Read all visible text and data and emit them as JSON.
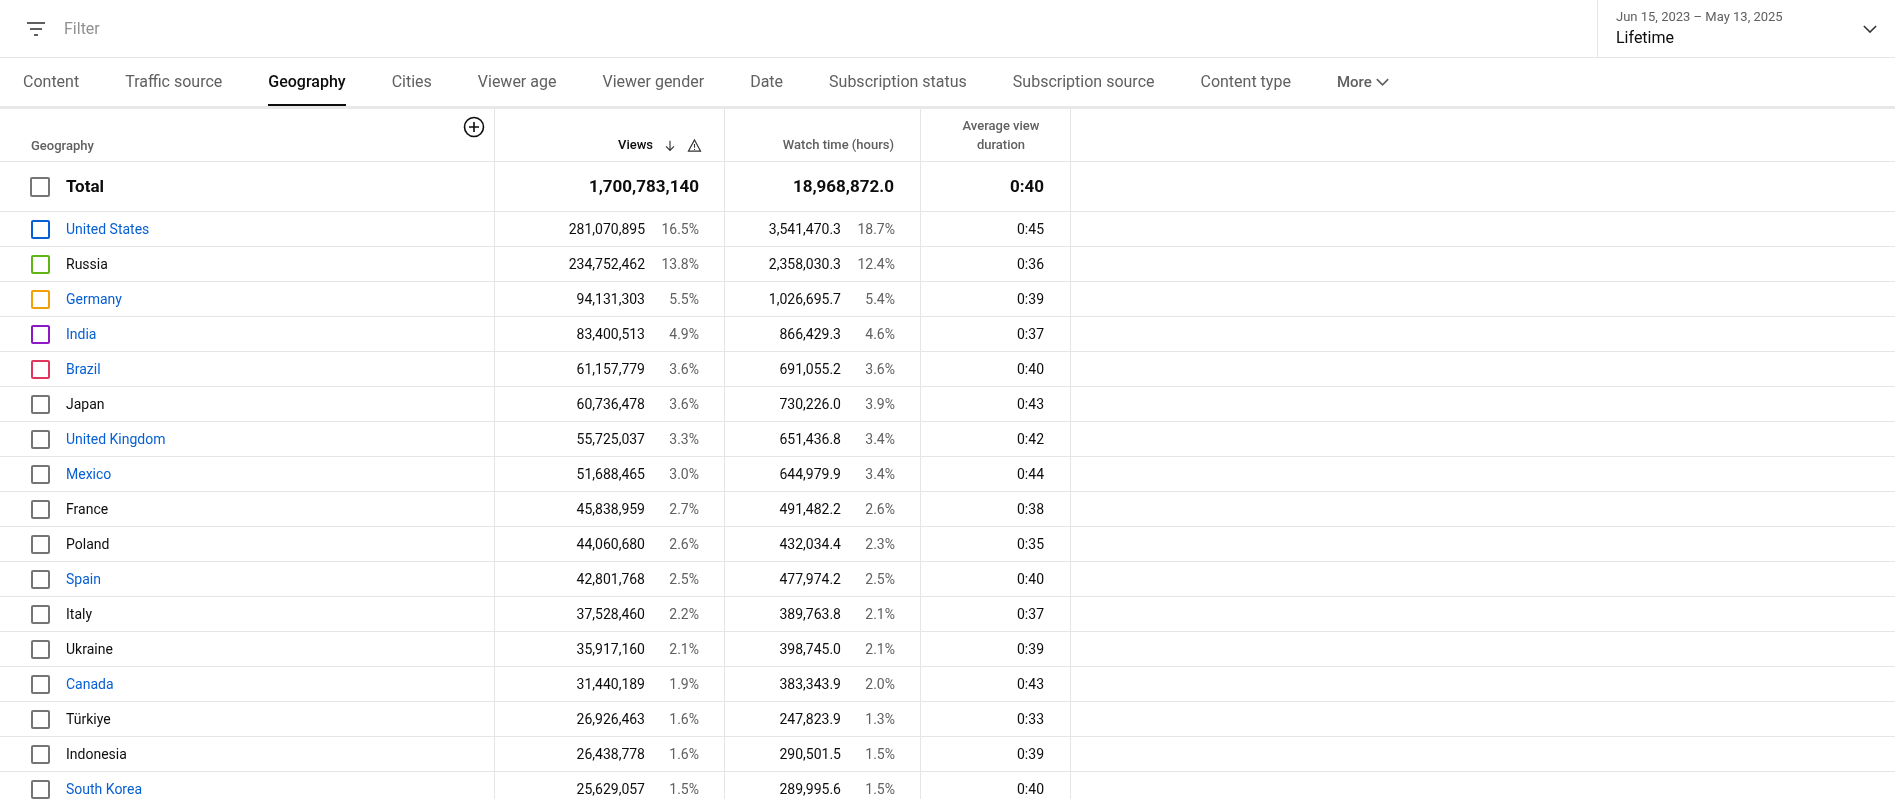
{
  "filter": {
    "placeholder": "Filter"
  },
  "date_range": {
    "range": "Jun 15, 2023 – May 13, 2025",
    "period": "Lifetime"
  },
  "tabs": [
    {
      "label": "Content",
      "selected": false
    },
    {
      "label": "Traffic source",
      "selected": false
    },
    {
      "label": "Geography",
      "selected": true
    },
    {
      "label": "Cities",
      "selected": false
    },
    {
      "label": "Viewer age",
      "selected": false
    },
    {
      "label": "Viewer gender",
      "selected": false
    },
    {
      "label": "Date",
      "selected": false
    },
    {
      "label": "Subscription status",
      "selected": false
    },
    {
      "label": "Subscription source",
      "selected": false
    },
    {
      "label": "Content type",
      "selected": false
    }
  ],
  "more_tab": {
    "label": "More"
  },
  "table": {
    "columns": [
      "Geography",
      "Views",
      "Watch time (hours)",
      "Average view duration"
    ],
    "total": {
      "label": "Total",
      "checked": false,
      "views": "1,700,783,140",
      "watch_time": "18,968,872.0",
      "avg_duration": "0:40"
    },
    "rows": [
      {
        "name": "United States",
        "link": true,
        "checked": false,
        "color": "#065fd4",
        "views": "281,070,895",
        "views_share": "16.5%",
        "watch_time": "3,541,470.3",
        "watch_share": "18.7%",
        "avg_duration": "0:45"
      },
      {
        "name": "Russia",
        "link": false,
        "checked": false,
        "color": "#60b515",
        "views": "234,752,462",
        "views_share": "13.8%",
        "watch_time": "2,358,030.3",
        "watch_share": "12.4%",
        "avg_duration": "0:36"
      },
      {
        "name": "Germany",
        "link": true,
        "checked": false,
        "color": "#f29f05",
        "views": "94,131,303",
        "views_share": "5.5%",
        "watch_time": "1,026,695.7",
        "watch_share": "5.4%",
        "avg_duration": "0:39"
      },
      {
        "name": "India",
        "link": true,
        "checked": false,
        "color": "#8d19c4",
        "views": "83,400,513",
        "views_share": "4.9%",
        "watch_time": "866,429.3",
        "watch_share": "4.6%",
        "avg_duration": "0:37"
      },
      {
        "name": "Brazil",
        "link": true,
        "checked": false,
        "color": "#e0365d",
        "views": "61,157,779",
        "views_share": "3.6%",
        "watch_time": "691,055.2",
        "watch_share": "3.6%",
        "avg_duration": "0:40"
      },
      {
        "name": "Japan",
        "link": false,
        "checked": false,
        "color": "#757575",
        "views": "60,736,478",
        "views_share": "3.6%",
        "watch_time": "730,226.0",
        "watch_share": "3.9%",
        "avg_duration": "0:43"
      },
      {
        "name": "United Kingdom",
        "link": true,
        "checked": false,
        "color": "#757575",
        "views": "55,725,037",
        "views_share": "3.3%",
        "watch_time": "651,436.8",
        "watch_share": "3.4%",
        "avg_duration": "0:42"
      },
      {
        "name": "Mexico",
        "link": true,
        "checked": false,
        "color": "#757575",
        "views": "51,688,465",
        "views_share": "3.0%",
        "watch_time": "644,979.9",
        "watch_share": "3.4%",
        "avg_duration": "0:44"
      },
      {
        "name": "France",
        "link": false,
        "checked": false,
        "color": "#757575",
        "views": "45,838,959",
        "views_share": "2.7%",
        "watch_time": "491,482.2",
        "watch_share": "2.6%",
        "avg_duration": "0:38"
      },
      {
        "name": "Poland",
        "link": false,
        "checked": false,
        "color": "#757575",
        "views": "44,060,680",
        "views_share": "2.6%",
        "watch_time": "432,034.4",
        "watch_share": "2.3%",
        "avg_duration": "0:35"
      },
      {
        "name": "Spain",
        "link": true,
        "checked": false,
        "color": "#757575",
        "views": "42,801,768",
        "views_share": "2.5%",
        "watch_time": "477,974.2",
        "watch_share": "2.5%",
        "avg_duration": "0:40"
      },
      {
        "name": "Italy",
        "link": false,
        "checked": false,
        "color": "#757575",
        "views": "37,528,460",
        "views_share": "2.2%",
        "watch_time": "389,763.8",
        "watch_share": "2.1%",
        "avg_duration": "0:37"
      },
      {
        "name": "Ukraine",
        "link": false,
        "checked": false,
        "color": "#757575",
        "views": "35,917,160",
        "views_share": "2.1%",
        "watch_time": "398,745.0",
        "watch_share": "2.1%",
        "avg_duration": "0:39"
      },
      {
        "name": "Canada",
        "link": true,
        "checked": false,
        "color": "#757575",
        "views": "31,440,189",
        "views_share": "1.9%",
        "watch_time": "383,343.9",
        "watch_share": "2.0%",
        "avg_duration": "0:43"
      },
      {
        "name": "Türkiye",
        "link": false,
        "checked": false,
        "color": "#757575",
        "views": "26,926,463",
        "views_share": "1.6%",
        "watch_time": "247,823.9",
        "watch_share": "1.3%",
        "avg_duration": "0:33"
      },
      {
        "name": "Indonesia",
        "link": false,
        "checked": false,
        "color": "#757575",
        "views": "26,438,778",
        "views_share": "1.6%",
        "watch_time": "290,501.5",
        "watch_share": "1.5%",
        "avg_duration": "0:39"
      },
      {
        "name": "South Korea",
        "link": true,
        "checked": false,
        "color": "#757575",
        "views": "25,629,057",
        "views_share": "1.5%",
        "watch_time": "289,995.6",
        "watch_share": "1.5%",
        "avg_duration": "0:40"
      }
    ]
  }
}
